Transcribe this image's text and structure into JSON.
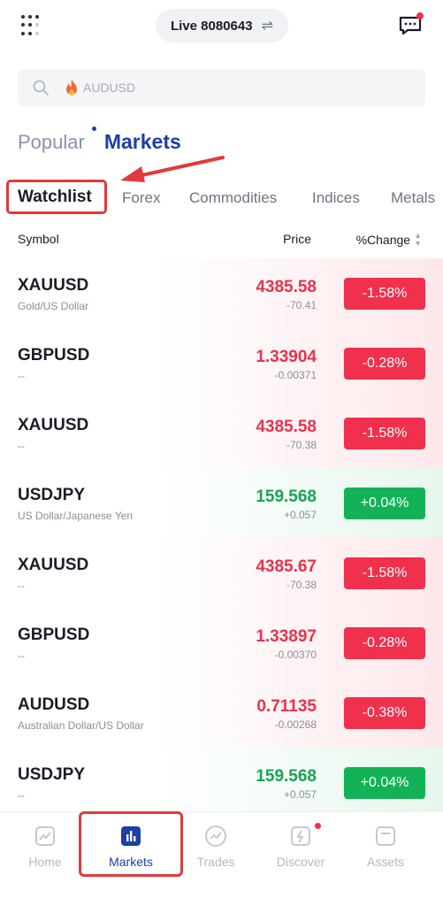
{
  "header": {
    "account_label": "Live 8080643"
  },
  "search": {
    "placeholder": "AUDUSD"
  },
  "section_tabs": {
    "popular": "Popular",
    "markets": "Markets"
  },
  "category_tabs": [
    "Watchlist",
    "Forex",
    "Commodities",
    "Indices",
    "Metals"
  ],
  "table_header": {
    "symbol": "Symbol",
    "price": "Price",
    "change": "%Change"
  },
  "rows": [
    {
      "symbol": "XAUUSD",
      "desc": "Gold/US Dollar",
      "price": "4385.58",
      "change": "-70.41",
      "pct": "-1.58%",
      "direction": "down"
    },
    {
      "symbol": "GBPUSD",
      "desc": "--",
      "price": "1.33904",
      "change": "-0.00371",
      "pct": "-0.28%",
      "direction": "down"
    },
    {
      "symbol": "XAUUSD",
      "desc": "--",
      "price": "4385.58",
      "change": "-70.38",
      "pct": "-1.58%",
      "direction": "down"
    },
    {
      "symbol": "USDJPY",
      "desc": "US Dollar/Japanese Yen",
      "price": "159.568",
      "change": "+0.057",
      "pct": "+0.04%",
      "direction": "up"
    },
    {
      "symbol": "XAUUSD",
      "desc": "--",
      "price": "4385.67",
      "change": "-70.38",
      "pct": "-1.58%",
      "direction": "down"
    },
    {
      "symbol": "GBPUSD",
      "desc": "--",
      "price": "1.33897",
      "change": "-0.00370",
      "pct": "-0.28%",
      "direction": "down"
    },
    {
      "symbol": "AUDUSD",
      "desc": "Australian Dollar/US Dollar",
      "price": "0.71135",
      "change": "-0.00268",
      "pct": "-0.38%",
      "direction": "down"
    },
    {
      "symbol": "USDJPY",
      "desc": "--",
      "price": "159.568",
      "change": "+0.057",
      "pct": "+0.04%",
      "direction": "up"
    }
  ],
  "bottom_nav": {
    "home": "Home",
    "markets": "Markets",
    "trades": "Trades",
    "discover": "Discover",
    "assets": "Assets"
  },
  "colors": {
    "accent": "#1c3fa8",
    "down": "#f0304c",
    "up": "#13b257",
    "annotation": "#e23a3a"
  }
}
